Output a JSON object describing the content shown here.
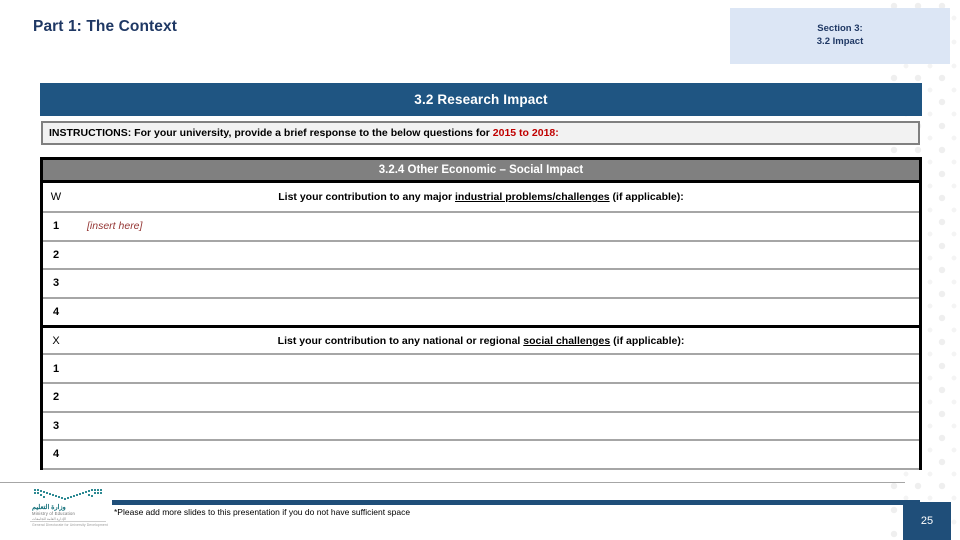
{
  "slide": {
    "title": "Part 1: The Context",
    "page_number": "25",
    "accent_blue": "#1f5582",
    "dark_navy": "#1f3864",
    "gray_header": "#808080",
    "red_accent": "#c00000",
    "insert_red": "#953735"
  },
  "section_banner": {
    "line1": "Section 3:",
    "line2": "3.2 Impact"
  },
  "header": {
    "title": "3.2 Research Impact"
  },
  "instructions": {
    "prefix": "INSTRUCTIONS: For your university, provide a brief response to the below questions for ",
    "years": "2015 to 2018:"
  },
  "subsection": {
    "title": "3.2.4 Other Economic – Social Impact"
  },
  "blocks": [
    {
      "marker": "W",
      "question_pre": "List your contribution to any major ",
      "question_underline": "industrial problems/challenges",
      "question_post": " (if applicable):",
      "rows": [
        {
          "num": "1",
          "value": "[insert here]"
        },
        {
          "num": "2",
          "value": ""
        },
        {
          "num": "3",
          "value": ""
        },
        {
          "num": "4",
          "value": ""
        }
      ]
    },
    {
      "marker": "X",
      "question_pre": "List your contribution to any national or regional ",
      "question_underline": "social challenges",
      "question_post": " (if applicable):",
      "rows": [
        {
          "num": "1",
          "value": ""
        },
        {
          "num": "2",
          "value": ""
        },
        {
          "num": "3",
          "value": ""
        },
        {
          "num": "4",
          "value": ""
        }
      ]
    }
  ],
  "footer": {
    "note": "*Please add more slides to this presentation if you do not have sufficient space",
    "logo": {
      "arabic": "وزارة التعليم",
      "english": "Ministry of Education",
      "sub_arabic": "الإدارة العامة للجامعات",
      "sub_english": "General Directorate for University Development"
    }
  }
}
